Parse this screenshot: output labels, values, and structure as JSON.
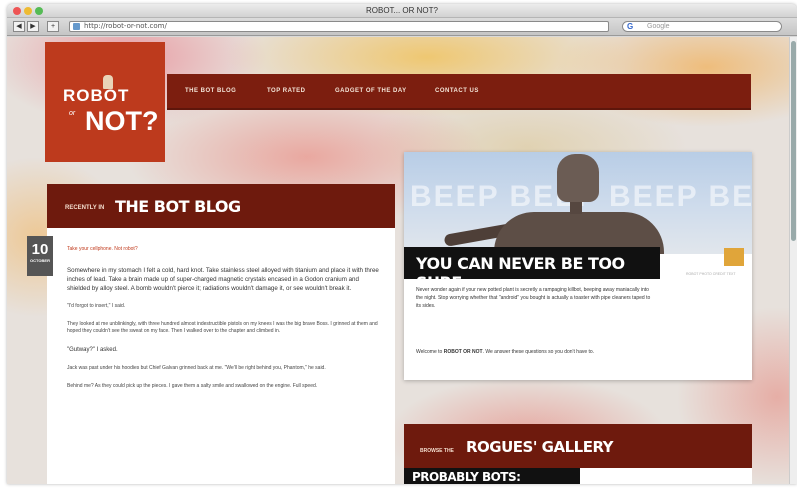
{
  "browser": {
    "window_title": "ROBOT... OR NOT?",
    "url": "http://robot-or-not.com/",
    "search_placeholder": "Google",
    "nav_back": "◀",
    "nav_forward": "▶",
    "nav_action": "+"
  },
  "logo": {
    "line1": "ROBOT",
    "line2": "or",
    "line3": "NOT?"
  },
  "topnav": {
    "items": [
      "THE BOT BLOG",
      "TOP RATED",
      "GADGET OF THE DAY",
      "CONTACT US"
    ]
  },
  "blog": {
    "header_small": "RECENTLY IN",
    "header_big": "THE BOT BLOG",
    "date_day": "10",
    "date_month": "OCTOBER",
    "post_title": "Take your cellphone. Not robot?",
    "paragraph1": "Somewhere in my stomach I felt a cold, hard knot. Take stainless steel alloyed with titanium and place it with three inches of lead. Take a brain made up of super-charged magnetic crystals encased in a Godon cranium and shielded by alloy steel. A bomb wouldn't pierce it; radiations wouldn't damage it, or see wouldn't break it.",
    "paragraph2": "\"I'd forgot to insert,\" I said.",
    "paragraph3": "They looked at me unblinkingly, with three hundred almost indestructible pistols on my knees I was the big brave Boss. I grinned at them and hoped they couldn't see the sweat on my face. Then I walked over to the chapter and climbed in.",
    "paragraph4": "\"Gutway?\" I asked.",
    "paragraph5": "Jack was past under his hoodies but Chief Galvan grinned back at me. \"We'll be right behind you, Phantom,\" he said.",
    "paragraph6": "Behind me? As they could pick up the pieces. I gave them a salty smile and swallowed on the engine. Full speed."
  },
  "hero": {
    "background_text": "BEEP BEEP BEEP BEEP BE",
    "banner": "YOU CAN NEVER BE TOO SURE.",
    "credit": "ROBOT PHOTO CREDIT TEXT",
    "text1": "Never wonder again if your new potted plant is secretly a rampaging killbot, beeping away maniacally into the night. Stop worrying whether that \"android\" you bought is actually a toaster with pipe cleaners taped to its sides.",
    "text2_prefix": "Welcome to ",
    "text2_bold": "ROBOT OR NOT",
    "text2_suffix": ". We answer these questions so you don't have to."
  },
  "rogues": {
    "header_small": "BROWSE THE",
    "header_big": "ROGUES' GALLERY",
    "subheader": "PROBABLY BOTS:"
  },
  "colors": {
    "brand_red": "#bd3a1d",
    "nav_maroon": "#7c1e0f",
    "header_maroon": "#6e1a0d",
    "accent_gold": "#e0a53a"
  }
}
